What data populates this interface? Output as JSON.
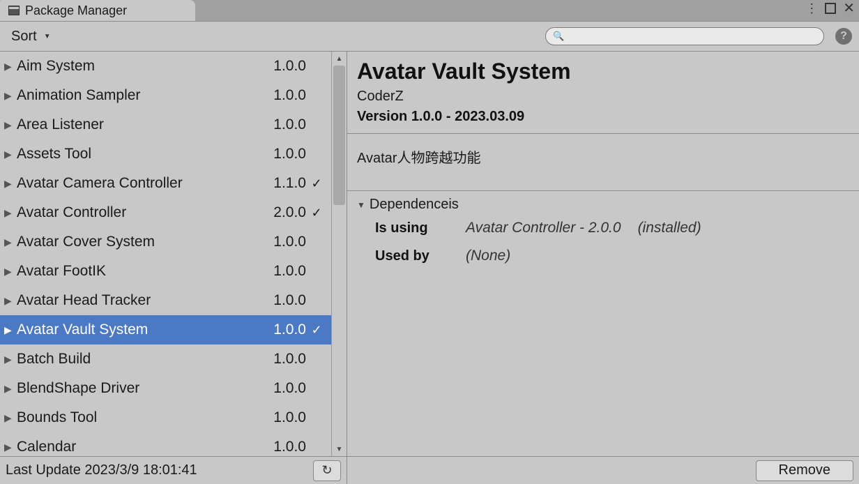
{
  "tab": {
    "title": "Package Manager"
  },
  "toolbar": {
    "sort_label": "Sort",
    "search_placeholder": ""
  },
  "packages": [
    {
      "name": "Aim System",
      "version": "1.0.0",
      "installed": false,
      "selected": false
    },
    {
      "name": "Animation Sampler",
      "version": "1.0.0",
      "installed": false,
      "selected": false
    },
    {
      "name": "Area Listener",
      "version": "1.0.0",
      "installed": false,
      "selected": false
    },
    {
      "name": "Assets Tool",
      "version": "1.0.0",
      "installed": false,
      "selected": false
    },
    {
      "name": "Avatar Camera Controller",
      "version": "1.1.0",
      "installed": true,
      "selected": false
    },
    {
      "name": "Avatar Controller",
      "version": "2.0.0",
      "installed": true,
      "selected": false
    },
    {
      "name": "Avatar Cover System",
      "version": "1.0.0",
      "installed": false,
      "selected": false
    },
    {
      "name": "Avatar FootIK",
      "version": "1.0.0",
      "installed": false,
      "selected": false
    },
    {
      "name": "Avatar Head Tracker",
      "version": "1.0.0",
      "installed": false,
      "selected": false
    },
    {
      "name": "Avatar Vault System",
      "version": "1.0.0",
      "installed": true,
      "selected": true
    },
    {
      "name": "Batch Build",
      "version": "1.0.0",
      "installed": false,
      "selected": false
    },
    {
      "name": "BlendShape Driver",
      "version": "1.0.0",
      "installed": false,
      "selected": false
    },
    {
      "name": "Bounds Tool",
      "version": "1.0.0",
      "installed": false,
      "selected": false
    },
    {
      "name": "Calendar",
      "version": "1.0.0",
      "installed": false,
      "selected": false
    }
  ],
  "footer": {
    "last_update": "Last Update 2023/3/9 18:01:41"
  },
  "detail": {
    "title": "Avatar Vault System",
    "author": "CoderZ",
    "version_line": "Version 1.0.0 - 2023.03.09",
    "description": "Avatar人物跨越功能",
    "deps_header": "Dependenceis",
    "is_using_label": "Is using",
    "is_using_value": "Avatar Controller - 2.0.0",
    "is_using_status": "(installed)",
    "used_by_label": "Used by",
    "used_by_value": "(None)",
    "remove_label": "Remove"
  }
}
